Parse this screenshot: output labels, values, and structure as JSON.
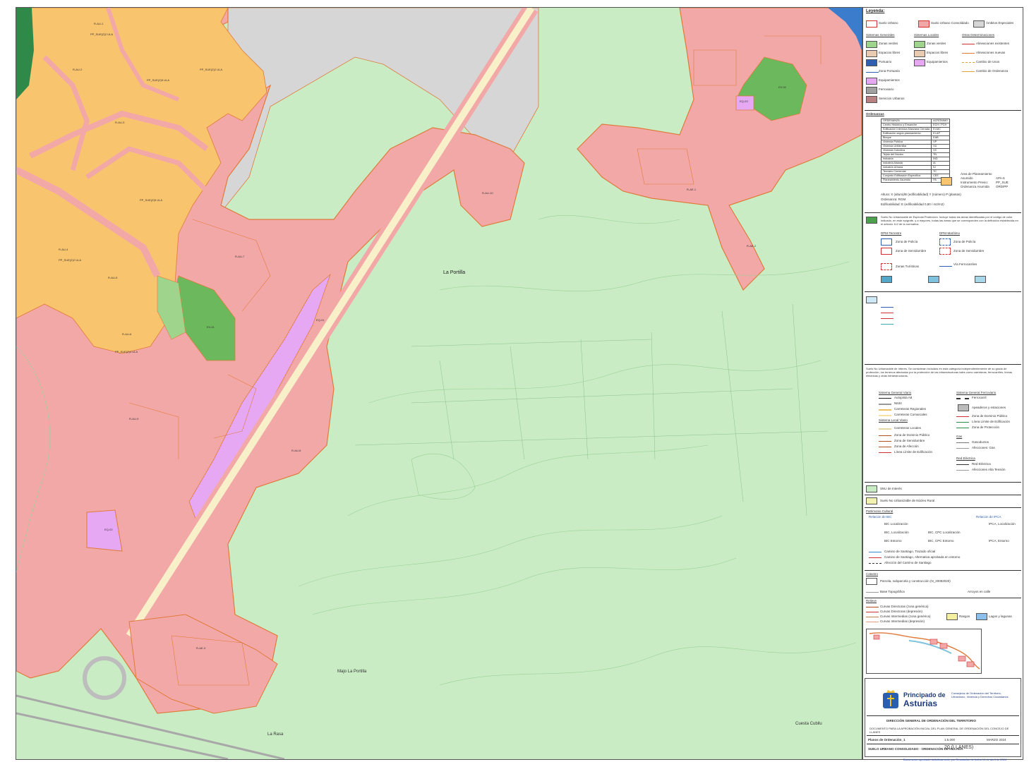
{
  "map": {
    "place_names": [
      "La Portilla",
      "Majo La Portilla",
      "La Rasa",
      "Cuesta Cubilu"
    ],
    "zone_codes": [
      "R-AU-1",
      "R-AU-2",
      "R-AU-3",
      "R-AU-4",
      "R-AU-5",
      "R-AU-6",
      "R-AU-7",
      "R-AU-8",
      "R-AU-9",
      "R-AU-10",
      "EQ-01",
      "EQ-02",
      "EQ-03",
      "EV-01",
      "EV-02",
      "R-AE-1",
      "R-AE-2",
      "R-AE-3"
    ],
    "sector_labels": [
      "PP_SUE(Z)2 ULA",
      "PP_SUE(Z)2 ULA",
      "PP_SUE(Z)5 ULA",
      "PP_SUE(Z)5 ULA",
      "PP_SUE(Z)2 ULA",
      "PP_SUE(Z)4 ULA"
    ]
  },
  "legend": {
    "title": "Leyenda:",
    "top_items": [
      "Suelo Urbano",
      "Suelo Urbano Consolidado",
      "Ámbitos Especiales"
    ],
    "headers": [
      "Sistemas Generales",
      "Sistemas Locales",
      "Otras Determinaciones"
    ],
    "sg_items": [
      "Zonas verdes",
      "Espacios libres",
      "Portuario",
      "Zona Portuaria",
      "Equipamientos",
      "Ferroviario",
      "Servicios Urbanos"
    ],
    "sl_items": [
      "Zonas verdes",
      "Espacios libres",
      "Equipamientos"
    ],
    "od_items": [
      "Alineaciones existentes",
      "Alineaciones nuevas",
      "Cambio de Usos",
      "Cambio de Ordenanza"
    ],
    "ordenanzas_title": "Ordenanzas",
    "ordenanzas_headers": [
      "ORDENANZA",
      "ACRÓNIMO"
    ],
    "ordenanzas": [
      [
        "Centro Histórico y Ensanche",
        "ECH / PCH"
      ],
      [
        "Edificación Intensiva Manzana Cerrada",
        "EI-MC"
      ],
      [
        "Edificación según planeamiento",
        "EI-AP"
      ],
      [
        "Bloque",
        "EAB"
      ],
      [
        "Vivienda Pública",
        "VP"
      ],
      [
        "Vivienda Unifamiliar",
        "VU"
      ],
      [
        "Vivienda Colectiva",
        "VC"
      ],
      [
        "Tejido del Núcleo",
        "TN"
      ],
      [
        "Industria",
        "IND"
      ],
      [
        "Industria Aislada",
        "IA"
      ],
      [
        "Industria Urbana",
        "IU"
      ],
      [
        "Terciario Comercial",
        "TC"
      ],
      [
        "Conjunto Edificación Específica",
        "CEE"
      ],
      [
        "Planeamiento Asumido",
        "PA"
      ]
    ],
    "side_note": [
      "Área de Planeamiento",
      "Asumido",
      "Instrumento Previo:",
      "Ordenanza Asumida"
    ],
    "side_codes": [
      "APA-5",
      "PP_SUE",
      "ORD/PP"
    ],
    "alturas_rows": [
      "Altura: X (altura)/B (edificabilidad) Y (número) P (plantas)",
      "Ordenanza: RGM",
      "Edificabilidad: E (edificabilidad 0,80 / m2/m2)"
    ],
    "sncpp_para": "Suelo No Urbanizable de Especial Protección. Incluye todas las áreas identificadas por el código de color indicado, en este epígrafe, y a mayores, todas las áreas que se corresponden con la definición establecida en el artículo 112 de la normativa.",
    "costas_titles": [
      "DPM-Terrestre",
      "DPM-Marítimo"
    ],
    "costas_items": [
      "Zona de Policía",
      "Zona de Servidumbre",
      "Zona de Policía",
      "Zona de Servidumbre",
      "Zonas Turísticas",
      "Vía Ferrocarriles"
    ],
    "sn_para": "Suelo No Urbanizable de Interés. Se consideran incluidos en esta categoría independientemente de su grado de protección, los terrenos afectados por la protección de las infraestructuras tales como carreteras, ferrocarriles, líneas eléctricas y otras infraestructuras.",
    "sgv_title": "Sistema General Viario",
    "sgv_items": [
      "Autopista A8",
      "N634",
      "Carreteras Regionales",
      "Carreteras Comarcales"
    ],
    "sgf_title": "Sistema General Ferroviario",
    "sgf_items": [
      "Ferrocarril",
      "Apeaderos y estaciones",
      "Zona de Dominio Público",
      "Línea Límite de Edificación",
      "Zona de Protección"
    ],
    "slv_title": "Sistema Local Viario",
    "slv_items": [
      "Carreteras Locales",
      "Zona de Dominio Público",
      "Zona de Servidumbre",
      "Zona de Afección",
      "Línea Límite de Edificación"
    ],
    "gas_title": "Gas",
    "gas_items": [
      "Gasoductos",
      "Afecciones: Gas"
    ],
    "elec_title": "Red Eléctrica",
    "elec_items": [
      "Red Eléctrica",
      "Afecciones Alta Tensión"
    ],
    "snu_items": [
      "SNU de Interés",
      "Suelo No Urbanizable de Núcleo Rural"
    ],
    "patrimonio_title": "Patrimonio Cultural",
    "bic_title": "Relación de BIC",
    "ipca_title": "Relación de IPCA",
    "patrimonio_items": [
      "BIC Localización",
      "BIC, Localización",
      "BIC, CPC Localización",
      "BIC Entorno",
      "BIC, CPC Entorno",
      "IPCA, Localización",
      "IPCA, Entorno",
      "Camino de Santiago, Trazado oficial",
      "Camino de Santiago, Alternativa aprobada en entorno",
      "Afección del Camino de Santiago"
    ],
    "catastro_title": "Catastro",
    "catastro_items": [
      "Parcela, subparcela y construcción (N_20082020)",
      "Base Topográfica",
      "Arroyos en calle"
    ],
    "relieve_title": "Relieve",
    "relieve_items": [
      "Curvas Directoras (zona genérica)",
      "Curvas Directoras (depresión)",
      "Curvas Intermedias (zona genérica)",
      "Curvas Intermedias (depresión)",
      "Rasgos",
      "Lagos y lagunas"
    ],
    "org": "Principado de Asturias",
    "org_line1": "Principado de",
    "org_line2": "Asturias",
    "consejeria": "Consejería de Ordenación del Territorio, Urbanismo, Vivienda y Derechos Ciudadanos",
    "direccion": "DIRECCIÓN GENERAL DE ORDENACIÓN DEL TERRITORIO",
    "documento": "DOCUMENTO PARA LA APROBACIÓN INICIAL DEL PLAN GENERAL DE ORDENACIÓN DEL CONCEJO DE LLANES",
    "plano_label": "Planos de Ordenación_1",
    "escala": "1:5.000",
    "fecha": "MARZO 2024",
    "serie": "SUELO URBANO CONSOLIDADO · ORDENACIÓN DETALLADA",
    "hoja": "20 (LLANES)",
    "footer_link": "Documento aprobado definitivamente por Resolución de fecha 14 de abril de 2024"
  },
  "colors": {
    "urbano": "#f3a8a8",
    "urbano_outline": "#e07a3b",
    "sector": "#f9c46e",
    "gris": "#d6d6d6",
    "snu": "#c9ecc4",
    "verde": "#6cb85c",
    "equip": "#e6a8f2",
    "via": "#f7f0c9",
    "mar": "#3b7ccc"
  }
}
